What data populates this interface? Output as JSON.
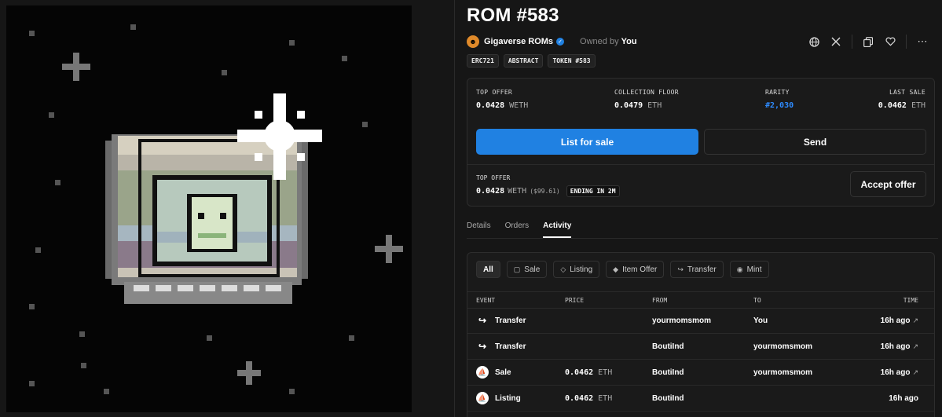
{
  "item": {
    "title": "ROM #583",
    "collection_name": "Gigaverse ROMs",
    "owned_by_label": "Owned by",
    "owner": "You",
    "tags": [
      "ERC721",
      "ABSTRACT",
      "TOKEN #583"
    ]
  },
  "stats": {
    "top_offer_label": "TOP OFFER",
    "top_offer_value": "0.0428",
    "top_offer_unit": "WETH",
    "floor_label": "COLLECTION FLOOR",
    "floor_value": "0.0479",
    "floor_unit": "ETH",
    "rarity_label": "RARITY",
    "rarity_value": "#2,030",
    "last_sale_label": "LAST SALE",
    "last_sale_value": "0.0462",
    "last_sale_unit": "ETH"
  },
  "actions": {
    "list_label": "List for sale",
    "send_label": "Send",
    "accept_label": "Accept offer"
  },
  "offer": {
    "label": "TOP OFFER",
    "value": "0.0428",
    "unit": "WETH",
    "usd": "($99.61)",
    "ending": "ENDING IN 2M"
  },
  "tabs": [
    "Details",
    "Orders",
    "Activity"
  ],
  "activity": {
    "filters": [
      "All",
      "Sale",
      "Listing",
      "Item Offer",
      "Transfer",
      "Mint"
    ],
    "columns": {
      "event": "EVENT",
      "price": "PRICE",
      "from": "FROM",
      "to": "TO",
      "time": "TIME"
    },
    "rows": [
      {
        "event": "Transfer",
        "price": "",
        "unit": "",
        "from": "yourmomsmom",
        "to": "You",
        "time": "16h ago",
        "arrow": "↗"
      },
      {
        "event": "Transfer",
        "price": "",
        "unit": "",
        "from": "BoutiInd",
        "to": "yourmomsmom",
        "time": "16h ago",
        "arrow": "↗"
      },
      {
        "event": "Sale",
        "price": "0.0462",
        "unit": "ETH",
        "from": "BoutiInd",
        "to": "yourmomsmom",
        "time": "16h ago",
        "arrow": "↗"
      },
      {
        "event": "Listing",
        "price": "0.0462",
        "unit": "ETH",
        "from": "BoutiInd",
        "to": "",
        "time": "16h ago",
        "arrow": ""
      }
    ]
  },
  "colors": {
    "accent": "#2081e2",
    "rarity": "#2e8bff",
    "background": "#161616"
  },
  "icons": [
    "globe-icon",
    "x-icon",
    "copy-icon",
    "heart-icon",
    "more-icon",
    "verified-icon"
  ]
}
